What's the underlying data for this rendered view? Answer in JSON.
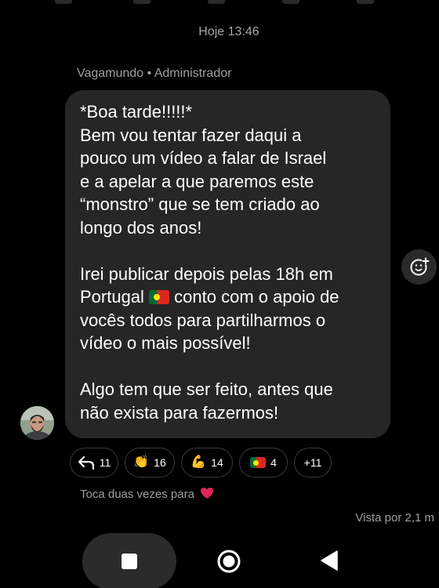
{
  "header": {
    "timestamp": "Hoje 13:46"
  },
  "message": {
    "sender": "Vagamundo",
    "role": "Administrador",
    "lines_intro": [
      "*Boa tarde!!!!!*",
      "Bem vou tentar fazer daqui a",
      "pouco um vídeo a falar de Israel",
      "e a apelar a que paremos este",
      "“monstro” que se tem criado ao",
      "longo dos anos!"
    ],
    "para2_line1": "Irei publicar depois pelas 18h em",
    "para2_line2_before": "Portugal ",
    "para2_line2_flag": "portugal-flag",
    "para2_line2_after": " conto com o apoio de",
    "para2_line3": "vocês todos para partilharmos o",
    "para2_line4": "vídeo o mais possível!",
    "para3_line1": "Algo tem que ser feito, antes que",
    "para3_line2": "não exista para fazermos!"
  },
  "reactions": [
    {
      "icon": "reply-arrow-icon",
      "count": "11"
    },
    {
      "icon": "clapping-hands-emoji",
      "glyph": "👏",
      "count": "16"
    },
    {
      "icon": "flexed-biceps-emoji",
      "glyph": "💪",
      "count": "14"
    },
    {
      "icon": "portugal-flag",
      "count": "4"
    },
    {
      "icon": "more-reactions",
      "count": "+11"
    }
  ],
  "hint": {
    "text": "Toca duas vezes para",
    "heart_icon": "red-heart-icon"
  },
  "seen": {
    "text": "Vista por 2,1 m"
  },
  "navbar": {
    "recents": "recents-square-icon",
    "home": "home-circle-icon",
    "back": "back-triangle-icon"
  },
  "colors": {
    "background": "#000000",
    "bubble": "#262626",
    "secondary_text": "#9f9f9f",
    "heart": "#e0245e"
  }
}
